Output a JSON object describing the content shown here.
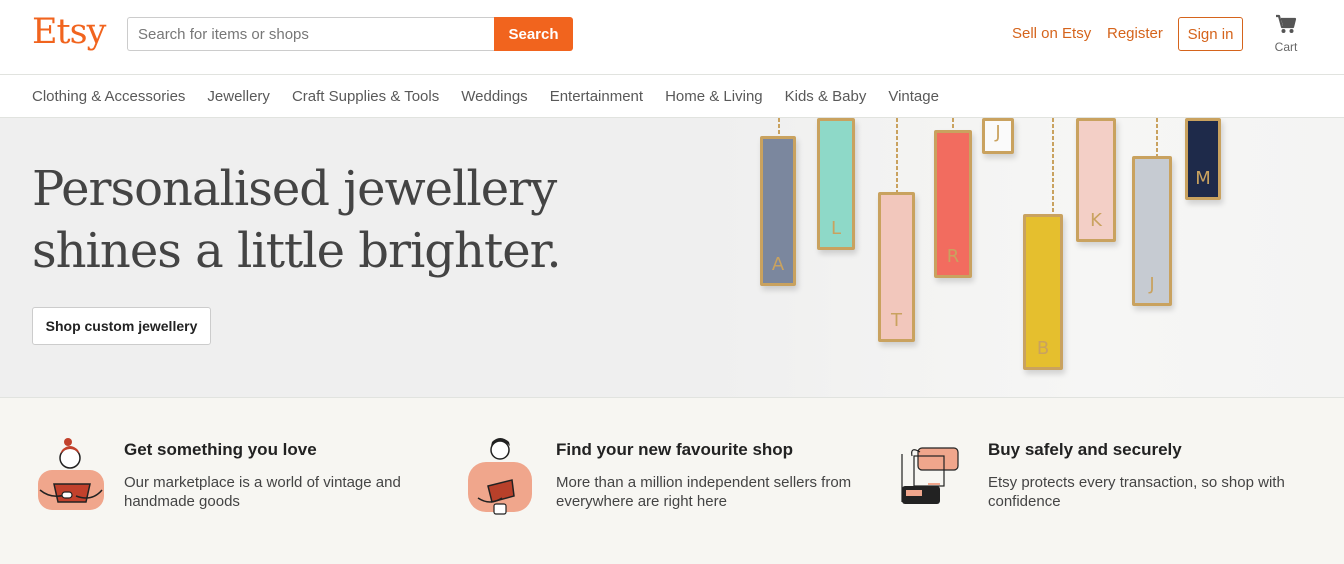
{
  "header": {
    "logo": "Etsy",
    "search_placeholder": "Search for items or shops",
    "search_button": "Search",
    "sell_link": "Sell on Etsy",
    "register_link": "Register",
    "signin_button": "Sign in",
    "cart_label": "Cart"
  },
  "categories": [
    "Clothing & Accessories",
    "Jewellery",
    "Craft Supplies & Tools",
    "Weddings",
    "Entertainment",
    "Home & Living",
    "Kids & Baby",
    "Vintage"
  ],
  "hero": {
    "title": "Personalised jewellery shines a little brighter.",
    "button": "Shop custom jewellery",
    "pendant_letters": [
      "A",
      "L",
      "T",
      "R",
      "J",
      "B",
      "K",
      "J",
      "M"
    ]
  },
  "props": [
    {
      "title": "Get something you love",
      "text": "Our marketplace is a world of vintage and handmade goods"
    },
    {
      "title": "Find your new favourite shop",
      "text": "More than a million independent sellers from everywhere are right here"
    },
    {
      "title": "Buy safely and securely",
      "text": "Etsy protects every transaction, so shop with confidence"
    }
  ],
  "colors": {
    "brand": "#f1641e",
    "link": "#d5641c"
  }
}
